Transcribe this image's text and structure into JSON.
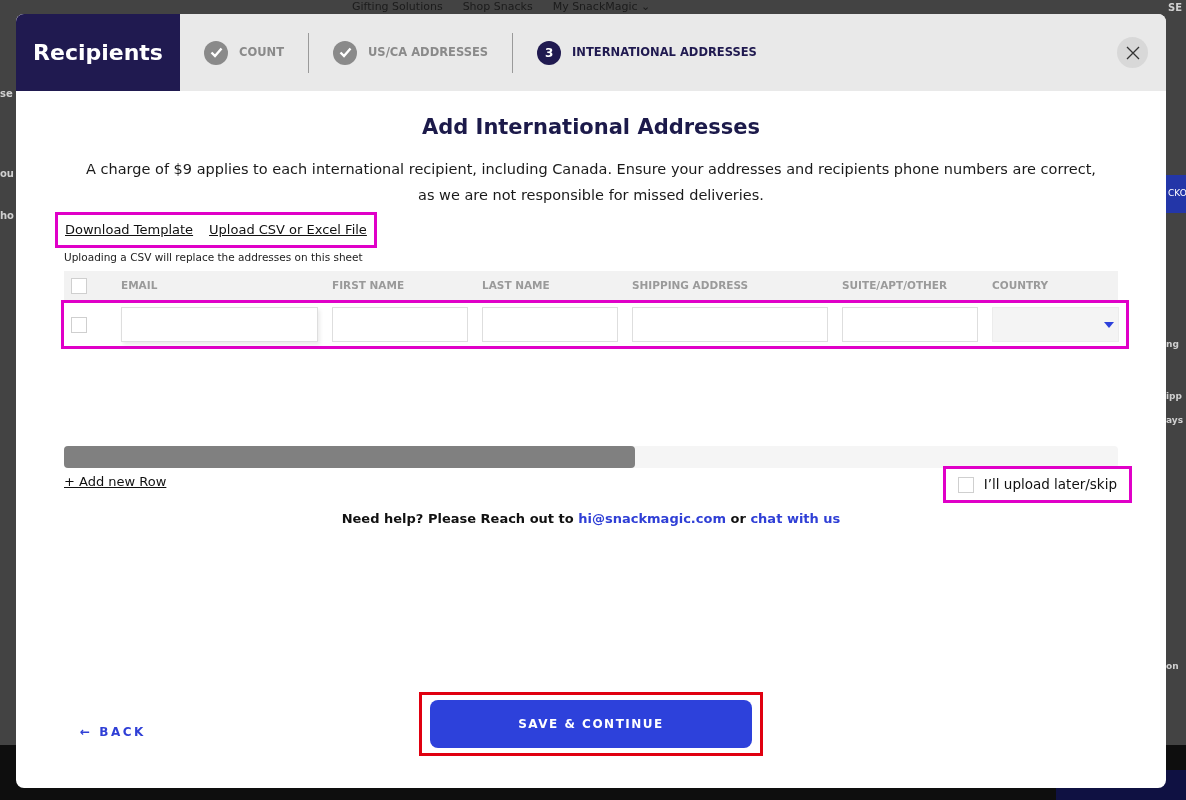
{
  "backdrop": {
    "nav": [
      "Gifting Solutions",
      "Shop Snacks",
      "My SnackMagic ⌄"
    ],
    "top_right": "SE",
    "left_fragments": [
      "se",
      "ou",
      "ho"
    ],
    "right_fragments": [
      "ng",
      "ipp",
      "ays",
      "on"
    ],
    "right_button": "CKO"
  },
  "modal": {
    "title": "Recipients",
    "steps": [
      {
        "label": "COUNT",
        "done": true,
        "selected": false
      },
      {
        "label": "US/CA ADDRESSES",
        "done": true,
        "selected": false
      },
      {
        "label": "INTERNATIONAL ADDRESSES",
        "number": "3",
        "done": false,
        "selected": true
      }
    ],
    "heading": "Add International Addresses",
    "notice": "A charge of $9 applies to each international recipient, including Canada. Ensure your addresses and recipients phone numbers are correct, as we are not responsible for missed deliveries.",
    "file_links": [
      "Download Template",
      "Upload CSV or Excel File"
    ],
    "upload_note": "Uploading a CSV will replace the addresses on this sheet",
    "table": {
      "select_all_checked": false,
      "columns": [
        "EMAIL",
        "FIRST NAME",
        "LAST NAME",
        "SHIPPING ADDRESS",
        "SUITE/APT/OTHER",
        "COUNTRY"
      ],
      "rows": [
        {
          "checked": false,
          "fields": [
            {
              "kind": "text"
            },
            {
              "kind": "text"
            },
            {
              "kind": "text"
            },
            {
              "kind": "text"
            },
            {
              "kind": "text"
            },
            {
              "kind": "select"
            }
          ]
        }
      ]
    },
    "add_row": "+ Add new Row",
    "skip": {
      "label": "I’ll upload later/skip",
      "checked": false
    },
    "help": {
      "text": "Need help? Please Reach out to",
      "email": "hi@snackmagic.com",
      "or": "or",
      "chat": "chat with us"
    },
    "back": "← BACK",
    "save": "SAVE & CONTINUE"
  }
}
